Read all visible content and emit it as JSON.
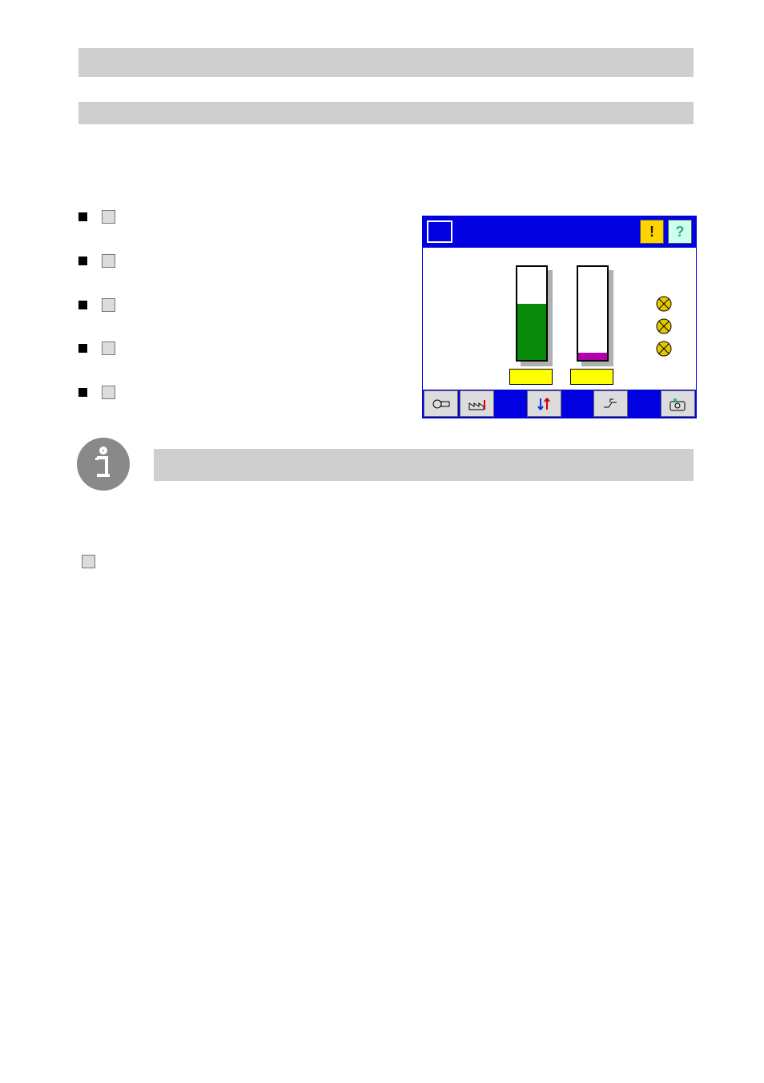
{
  "bars": {
    "top": "",
    "second": ""
  },
  "leftColumn": {
    "intro": "",
    "items": [
      {
        "text_before": "",
        "icon_name": "adjust-brg-icon",
        "text_after": ""
      },
      {
        "text_before": "",
        "icon_name": "factory-icon",
        "text_after": ""
      },
      {
        "text_before": "",
        "icon_name": "up-down-arrows-icon",
        "text_after": ""
      },
      {
        "text_before": "",
        "icon_name": "hand-icon",
        "text_after": ""
      },
      {
        "text_before": "",
        "icon_name": "recycle-icon",
        "text_after": ""
      }
    ]
  },
  "infoNote": "",
  "belowInfo": {
    "text_before": "",
    "icon_name": "tanks-icon",
    "text_after": ""
  },
  "hmi": {
    "header": {
      "warn_label": "!",
      "help_label": "?"
    },
    "tanks": {
      "a": {
        "fill_pct": 60,
        "fill_color": "#0a8a0a",
        "label": ""
      },
      "b": {
        "fill_pct": 8,
        "fill_color": "#b000b0",
        "label": ""
      }
    },
    "lamps": [
      {
        "color": "#e6c800"
      },
      {
        "color": "#e6c800"
      },
      {
        "color": "#e6c800"
      }
    ],
    "footer_buttons": [
      "adjust-brg-icon",
      "factory-icon",
      null,
      "up-down-arrows-icon",
      null,
      "valve-icon",
      null,
      "camera-icon"
    ]
  }
}
